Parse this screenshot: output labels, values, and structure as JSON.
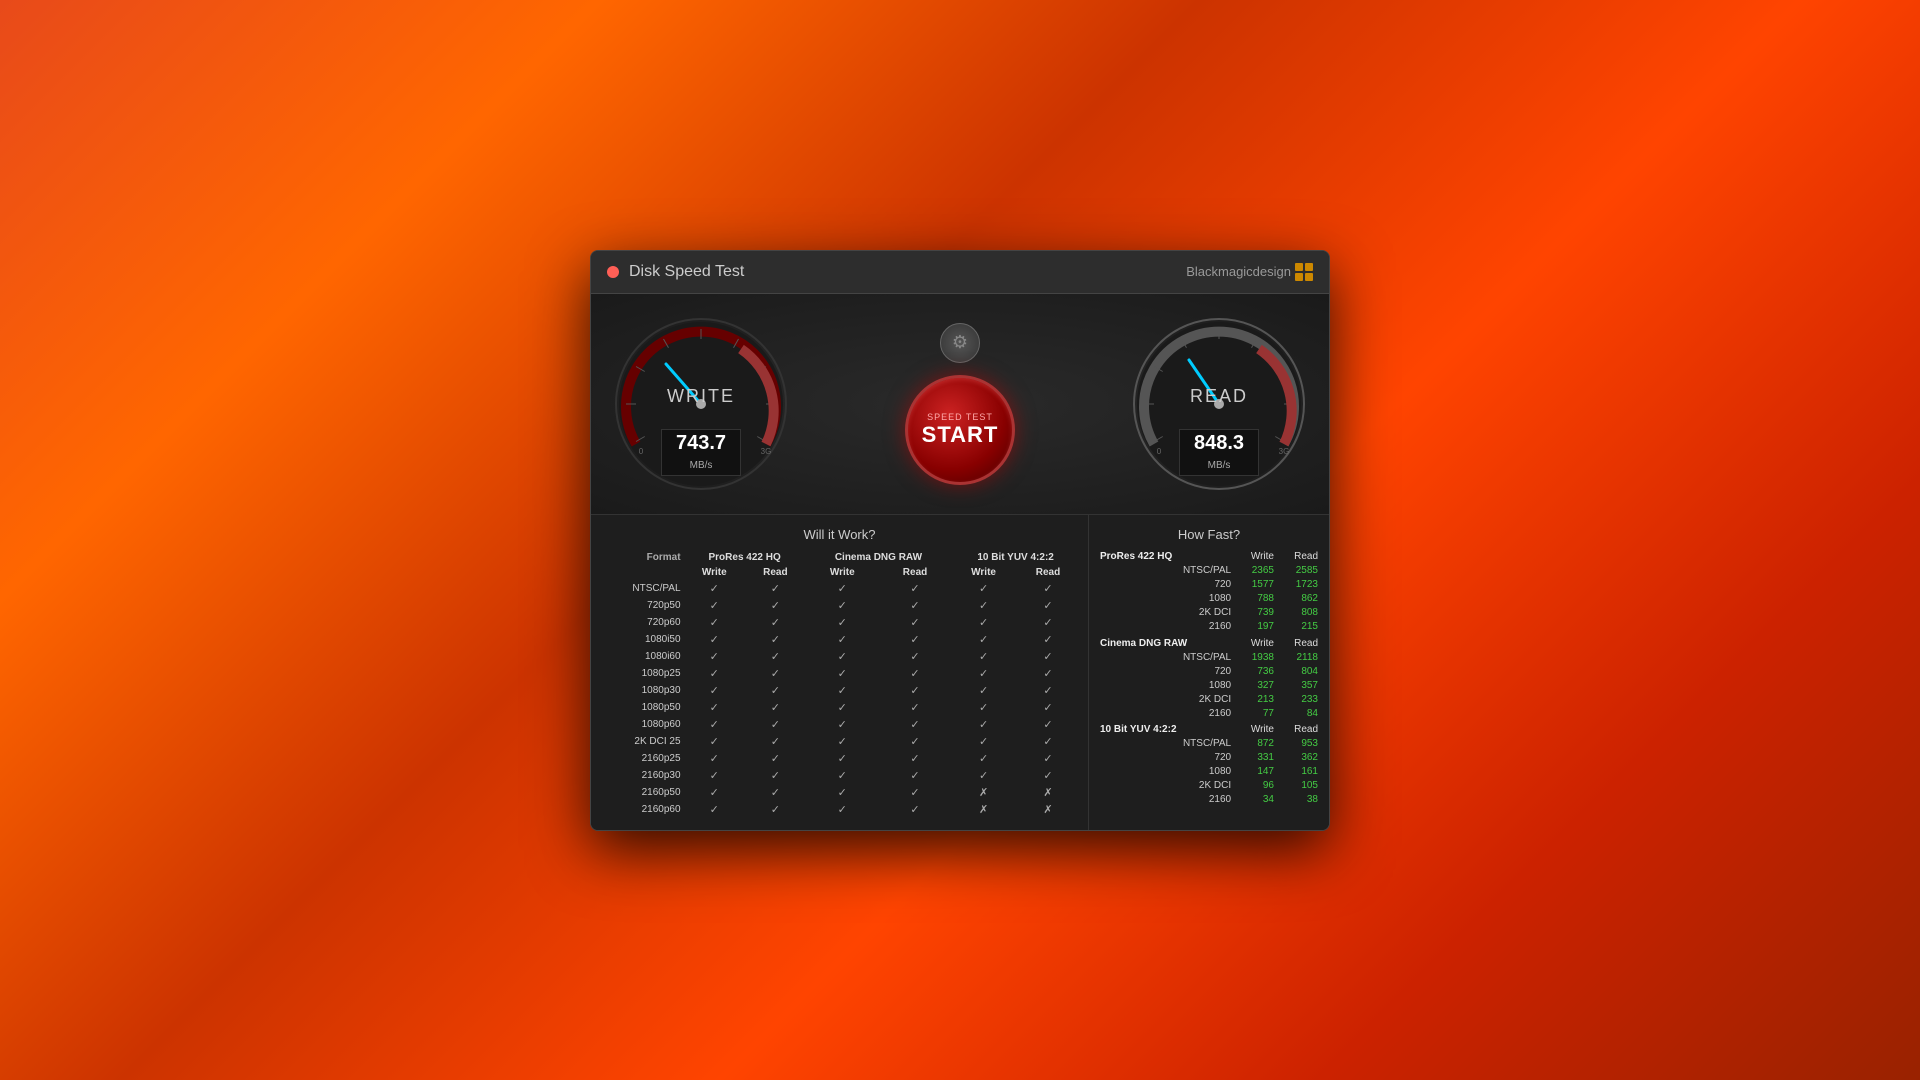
{
  "window": {
    "title": "Disk Speed Test",
    "brand": "Blackmagicdesign"
  },
  "gauges": {
    "write": {
      "label": "WRITE",
      "value": "743.7",
      "unit": "MB/s",
      "needle_angle": -30
    },
    "read": {
      "label": "READ",
      "value": "848.3",
      "unit": "MB/s",
      "needle_angle": -20
    }
  },
  "start_button": {
    "small_label": "SPEED TEST",
    "main_label": "START"
  },
  "will_it_work": {
    "title": "Will it Work?",
    "columns": {
      "format_label": "Format",
      "groups": [
        {
          "name": "ProRes 422 HQ",
          "cols": [
            "Write",
            "Read"
          ]
        },
        {
          "name": "Cinema DNG RAW",
          "cols": [
            "Write",
            "Read"
          ]
        },
        {
          "name": "10 Bit YUV 4:2:2",
          "cols": [
            "Write",
            "Read"
          ]
        }
      ]
    },
    "rows": [
      {
        "label": "NTSC/PAL",
        "vals": [
          "✓",
          "✓",
          "✓",
          "✓",
          "✓",
          "✓"
        ]
      },
      {
        "label": "720p50",
        "vals": [
          "✓",
          "✓",
          "✓",
          "✓",
          "✓",
          "✓"
        ]
      },
      {
        "label": "720p60",
        "vals": [
          "✓",
          "✓",
          "✓",
          "✓",
          "✓",
          "✓"
        ]
      },
      {
        "label": "1080i50",
        "vals": [
          "✓",
          "✓",
          "✓",
          "✓",
          "✓",
          "✓"
        ]
      },
      {
        "label": "1080i60",
        "vals": [
          "✓",
          "✓",
          "✓",
          "✓",
          "✓",
          "✓"
        ]
      },
      {
        "label": "1080p25",
        "vals": [
          "✓",
          "✓",
          "✓",
          "✓",
          "✓",
          "✓"
        ]
      },
      {
        "label": "1080p30",
        "vals": [
          "✓",
          "✓",
          "✓",
          "✓",
          "✓",
          "✓"
        ]
      },
      {
        "label": "1080p50",
        "vals": [
          "✓",
          "✓",
          "✓",
          "✓",
          "✓",
          "✓"
        ]
      },
      {
        "label": "1080p60",
        "vals": [
          "✓",
          "✓",
          "✓",
          "✓",
          "✓",
          "✓"
        ]
      },
      {
        "label": "2K DCI 25",
        "vals": [
          "✓",
          "✓",
          "✓",
          "✓",
          "✓",
          "✓"
        ]
      },
      {
        "label": "2160p25",
        "vals": [
          "✓",
          "✓",
          "✓",
          "✓",
          "✓",
          "✓"
        ]
      },
      {
        "label": "2160p30",
        "vals": [
          "✓",
          "✓",
          "✓",
          "✓",
          "✓",
          "✓"
        ]
      },
      {
        "label": "2160p50",
        "vals": [
          "✓",
          "✓",
          "✓",
          "✓",
          "✗",
          "✗"
        ]
      },
      {
        "label": "2160p60",
        "vals": [
          "✓",
          "✓",
          "✓",
          "✓",
          "✗",
          "✗"
        ]
      }
    ]
  },
  "how_fast": {
    "title": "How Fast?",
    "sections": [
      {
        "name": "ProRes 422 HQ",
        "col_write": "Write",
        "col_read": "Read",
        "rows": [
          {
            "label": "NTSC/PAL",
            "write": "2365",
            "read": "2585"
          },
          {
            "label": "720",
            "write": "1577",
            "read": "1723"
          },
          {
            "label": "1080",
            "write": "788",
            "read": "862"
          },
          {
            "label": "2K DCI",
            "write": "739",
            "read": "808"
          },
          {
            "label": "2160",
            "write": "197",
            "read": "215"
          }
        ]
      },
      {
        "name": "Cinema DNG RAW",
        "col_write": "Write",
        "col_read": "Read",
        "rows": [
          {
            "label": "NTSC/PAL",
            "write": "1938",
            "read": "2118"
          },
          {
            "label": "720",
            "write": "736",
            "read": "804"
          },
          {
            "label": "1080",
            "write": "327",
            "read": "357"
          },
          {
            "label": "2K DCI",
            "write": "213",
            "read": "233"
          },
          {
            "label": "2160",
            "write": "77",
            "read": "84"
          }
        ]
      },
      {
        "name": "10 Bit YUV 4:2:2",
        "col_write": "Write",
        "col_read": "Read",
        "rows": [
          {
            "label": "NTSC/PAL",
            "write": "872",
            "read": "953"
          },
          {
            "label": "720",
            "write": "331",
            "read": "362"
          },
          {
            "label": "1080",
            "write": "147",
            "read": "161"
          },
          {
            "label": "2K DCI",
            "write": "96",
            "read": "105"
          },
          {
            "label": "2160",
            "write": "34",
            "read": "38"
          }
        ]
      }
    ]
  }
}
